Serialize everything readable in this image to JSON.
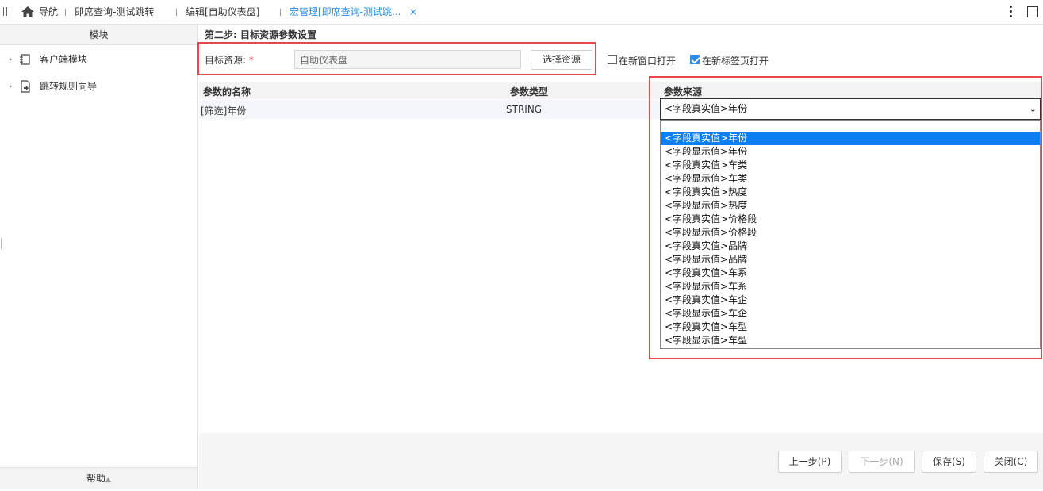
{
  "topbar": {
    "tabs": [
      {
        "label": "导航"
      },
      {
        "label": "即席查询-测试跳转"
      },
      {
        "label": "编辑[自助仪表盘]"
      },
      {
        "label": "宏管理[即席查询-测试跳..."
      }
    ],
    "close_glyph": "×"
  },
  "sidebar": {
    "header": "模块",
    "items": [
      {
        "label": "客户端模块",
        "icon": "client-module-icon"
      },
      {
        "label": "跳转规则向导",
        "icon": "jump-rule-icon"
      }
    ],
    "footer": "帮助"
  },
  "main": {
    "step_title": "第二步: 目标资源参数设置",
    "target_label": "目标资源:",
    "required_mark": "*",
    "target_value": "自助仪表盘",
    "choose_button": "选择资源",
    "new_window_label": "在新窗口打开",
    "new_window_checked": false,
    "new_tab_label": "在新标签页打开",
    "new_tab_checked": true,
    "columns": [
      "参数的名称",
      "参数类型",
      "参数来源"
    ],
    "rows": [
      {
        "name": "[筛选]年份",
        "type": "STRING",
        "source": "<字段真实值>年份"
      }
    ],
    "dropdown_options": [
      "<字段真实值>年份",
      "<字段显示值>年份",
      "<字段真实值>车类",
      "<字段显示值>车类",
      "<字段真实值>热度",
      "<字段显示值>热度",
      "<字段真实值>价格段",
      "<字段显示值>价格段",
      "<字段真实值>品牌",
      "<字段显示值>品牌",
      "<字段真实值>车系",
      "<字段显示值>车系",
      "<字段真实值>车企",
      "<字段显示值>车企",
      "<字段真实值>车型",
      "<字段显示值>车型"
    ],
    "selected_option_index": 0
  },
  "footer_buttons": {
    "prev": "上一步(P)",
    "next": "下一步(N)",
    "save": "保存(S)",
    "close": "关闭(C)"
  },
  "colors": {
    "accent": "#2a8ce5",
    "highlight_box": "#e9474b",
    "selected_option": "#0b7ff2"
  }
}
